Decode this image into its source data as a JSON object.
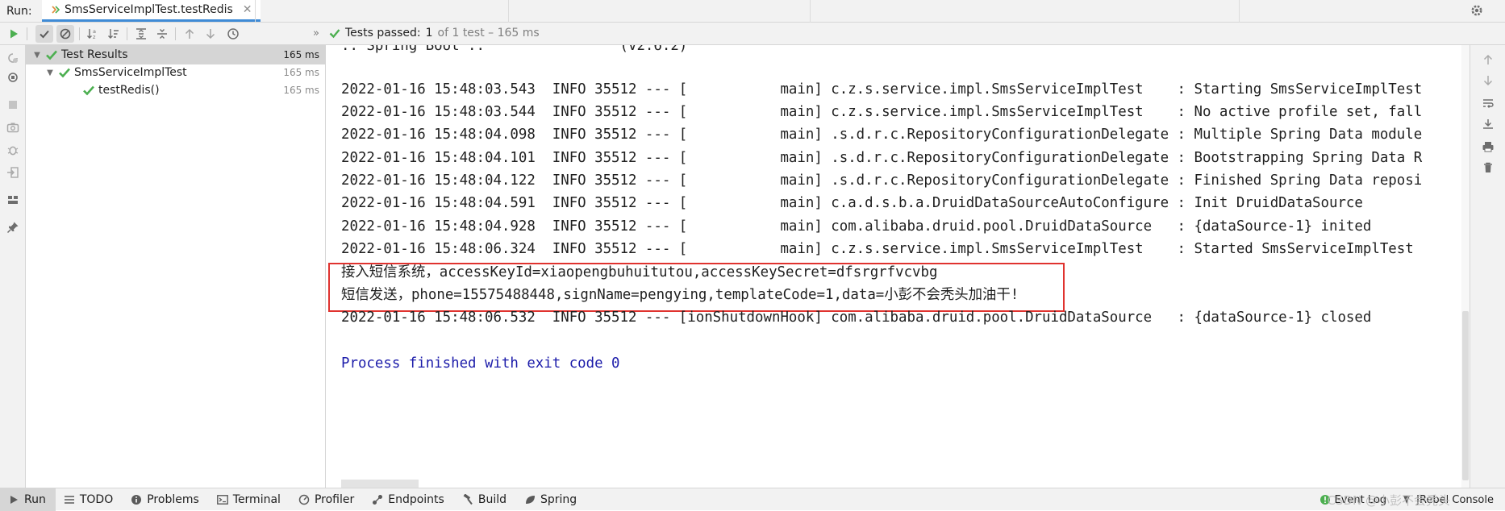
{
  "topbar": {
    "run_label": "Run:",
    "tab_title": "SmsServiceImplTest.testRedis"
  },
  "toolbar": {
    "status_label": "Tests passed:",
    "status_passed": "1",
    "status_detail": "of 1 test – 165 ms"
  },
  "tree": {
    "items": [
      {
        "label": "Test Results",
        "time": "165 ms"
      },
      {
        "label": "SmsServiceImplTest",
        "time": "165 ms"
      },
      {
        "label": "testRedis()",
        "time": "165 ms"
      }
    ]
  },
  "console": {
    "top_partial": ":: Spring Boot ::                (v2.6.2)",
    "lines": [
      "2022-01-16 15:48:03.543  INFO 35512 --- [           main] c.z.s.service.impl.SmsServiceImplTest    : Starting SmsServiceImplTest",
      "2022-01-16 15:48:03.544  INFO 35512 --- [           main] c.z.s.service.impl.SmsServiceImplTest    : No active profile set, fall",
      "2022-01-16 15:48:04.098  INFO 35512 --- [           main] .s.d.r.c.RepositoryConfigurationDelegate : Multiple Spring Data module",
      "2022-01-16 15:48:04.101  INFO 35512 --- [           main] .s.d.r.c.RepositoryConfigurationDelegate : Bootstrapping Spring Data R",
      "2022-01-16 15:48:04.122  INFO 35512 --- [           main] .s.d.r.c.RepositoryConfigurationDelegate : Finished Spring Data reposi",
      "2022-01-16 15:48:04.591  INFO 35512 --- [           main] c.a.d.s.b.a.DruidDataSourceAutoConfigure : Init DruidDataSource",
      "2022-01-16 15:48:04.928  INFO 35512 --- [           main] com.alibaba.druid.pool.DruidDataSource   : {dataSource-1} inited",
      "2022-01-16 15:48:06.324  INFO 35512 --- [           main] c.z.s.service.impl.SmsServiceImplTest    : Started SmsServiceImplTest"
    ],
    "highlighted": [
      "接入短信系统，accessKeyId=xiaopengbuhuitutou,accessKeySecret=dfsrgrfvcvbg",
      "短信发送，phone=15575488448,signName=pengying,templateCode=1,data=小彭不会秃头加油干!"
    ],
    "after": "2022-01-16 15:48:06.532  INFO 35512 --- [ionShutdownHook] com.alibaba.druid.pool.DruidDataSource   : {dataSource-1} closed",
    "process": "Process finished with exit code 0"
  },
  "bottombar": {
    "tabs": [
      {
        "label": "Run",
        "icon": "play-icon"
      },
      {
        "label": "TODO",
        "icon": "list-icon"
      },
      {
        "label": "Problems",
        "icon": "info-icon"
      },
      {
        "label": "Terminal",
        "icon": "terminal-icon"
      },
      {
        "label": "Profiler",
        "icon": "profiler-icon"
      },
      {
        "label": "Endpoints",
        "icon": "endpoints-icon"
      },
      {
        "label": "Build",
        "icon": "hammer-icon"
      },
      {
        "label": "Spring",
        "icon": "leaf-icon"
      }
    ],
    "event_log": "Event Log",
    "jrebel": "JRebel Console",
    "watermark": "CSDN @小彭不会秃头"
  },
  "colors": {
    "accent": "#3f8bd6",
    "pass_green": "#4caf50",
    "highlight_red": "#e0332f",
    "process_blue": "#1c1caa"
  }
}
